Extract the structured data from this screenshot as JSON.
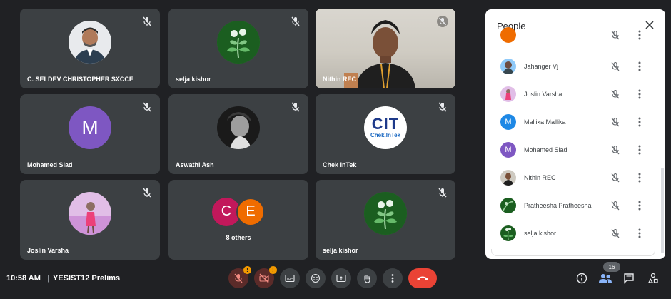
{
  "tiles": [
    {
      "name": "C. SELDEV CHRISTOPHER SXCCE"
    },
    {
      "name": "selja kishor"
    },
    {
      "name": "Nithin REC"
    },
    {
      "name": "Mohamed Siad",
      "initial": "M"
    },
    {
      "name": "Aswathi Ash"
    },
    {
      "name": "Chek InTek",
      "logo_big": "CIT",
      "logo_small": "Chek.InTek"
    },
    {
      "name": "Joslin Varsha"
    },
    {
      "name": "8 others",
      "bubbles": [
        "C",
        "E"
      ]
    },
    {
      "name": "selja kishor"
    }
  ],
  "people_panel": {
    "title": "People",
    "participants": [
      {
        "name": "Jahanger Vj"
      },
      {
        "name": "Joslin Varsha"
      },
      {
        "name": "Mallika Mallika",
        "initial": "M",
        "color": "#1e88e5"
      },
      {
        "name": "Mohamed Siad",
        "initial": "M",
        "color": "#7e57c2"
      },
      {
        "name": "Nithin REC"
      },
      {
        "name": "Pratheesha Pratheesha"
      },
      {
        "name": "selja kishor"
      }
    ]
  },
  "bottom_bar": {
    "time": "10:58 AM",
    "separator": "|",
    "meeting_name": "YESIST12 Prelims",
    "participant_count": "16"
  },
  "colors": {
    "background": "#202124",
    "tile": "#3c4043",
    "end_call": "#ea4335",
    "warning": "#f29900"
  }
}
